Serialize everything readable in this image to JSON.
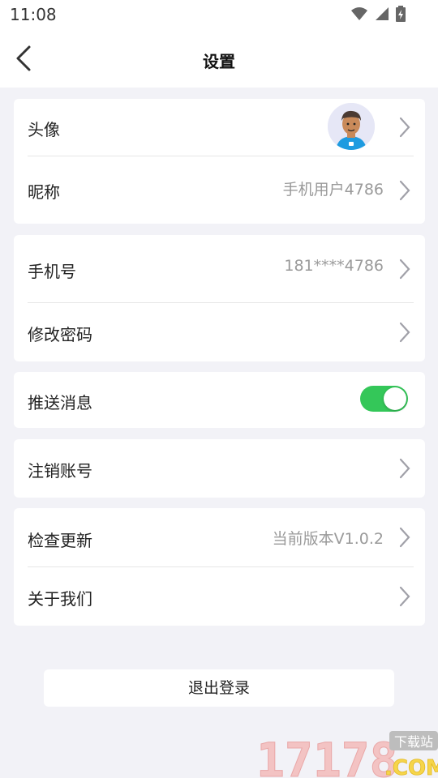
{
  "status_bar": {
    "time": "11:08",
    "icons": [
      "wifi-icon",
      "signal-icon",
      "battery-icon"
    ]
  },
  "header": {
    "title": "设置"
  },
  "sections": {
    "profile": {
      "avatar_label": "头像",
      "nickname_label": "昵称",
      "nickname_value": "手机用户4786"
    },
    "account": {
      "phone_label": "手机号",
      "phone_value": "181****4786",
      "password_label": "修改密码"
    },
    "push": {
      "label": "推送消息",
      "enabled": true
    },
    "cancel": {
      "label": "注销账号"
    },
    "about": {
      "update_label": "检查更新",
      "version_value": "当前版本V1.0.2",
      "about_label": "关于我们"
    }
  },
  "logout_label": "退出登录",
  "watermark": {
    "number": "17178",
    "tag": "下载站",
    "domain": ".COM"
  },
  "colors": {
    "toggle_on": "#34c759",
    "background": "#f2f2f7",
    "chevron": "#a0a0a8"
  }
}
